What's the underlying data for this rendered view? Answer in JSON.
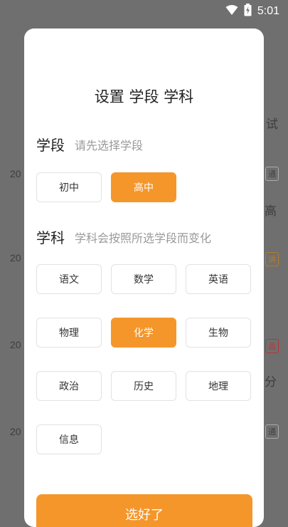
{
  "status_bar": {
    "time": "5:01"
  },
  "background": {
    "year_fragment": "20",
    "row_texts": [
      "试",
      "高"
    ],
    "badges": [
      "通",
      "讲",
      "品",
      "通"
    ],
    "side_text": "分"
  },
  "dialog": {
    "title": "设置 学段 学科",
    "stage": {
      "label": "学段",
      "hint": "请先选择学段",
      "options": [
        "初中",
        "高中"
      ],
      "selected": "高中"
    },
    "subject": {
      "label": "学科",
      "hint": "学科会按照所选学段而变化",
      "options": [
        "语文",
        "数学",
        "英语",
        "物理",
        "化学",
        "生物",
        "政治",
        "历史",
        "地理",
        "信息"
      ],
      "selected": "化学"
    },
    "confirm_label": "选好了"
  },
  "colors": {
    "accent": "#f5962a",
    "overlay": "#6f6f6f"
  }
}
